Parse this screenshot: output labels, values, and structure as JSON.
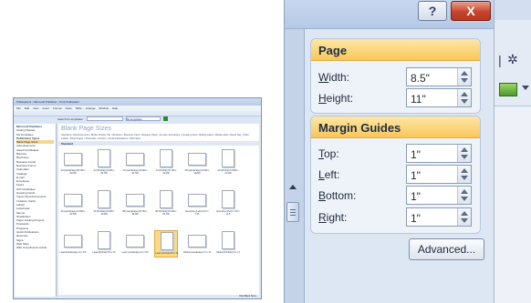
{
  "dialog": {
    "help_label": "?",
    "close_label": "X",
    "page_group": {
      "title": "Page",
      "width_label_u": "W",
      "width_label_rest": "idth:",
      "width_value": "8.5\"",
      "height_label_u": "H",
      "height_label_rest": "eight:",
      "height_value": "11\""
    },
    "margin_group": {
      "title": "Margin Guides",
      "top_label_u": "T",
      "top_label_rest": "op:",
      "top_value": "1\"",
      "left_label_u": "L",
      "left_label_rest": "eft:",
      "left_value": "1\"",
      "bottom_label_u": "B",
      "bottom_label_rest": "ottom:",
      "bottom_value": "1\"",
      "right_label_u": "R",
      "right_label_rest": "ight:",
      "right_value": "1\""
    },
    "advanced_label": "Advanced..."
  },
  "background_app": {
    "icons": [
      "|",
      "✲"
    ]
  },
  "thumbnail": {
    "title": "Publication1 - Microsoft Publisher - Print Publication",
    "menu": [
      "File",
      "Edit",
      "View",
      "Insert",
      "Format",
      "Tools",
      "Table",
      "Arrange",
      "Window",
      "Help"
    ],
    "search_label": "Search for templates:",
    "search_scope": "All templates",
    "sidebar_heading1": "Microsoft Publisher",
    "sidebar_top": [
      "Getting Started",
      "My Templates"
    ],
    "sidebar_heading2": "Publication Types",
    "sidebar_items": [
      "Blank Page Sizes",
      "Advertisements",
      "Award Certificates",
      "Banners",
      "Brochures",
      "Business Cards",
      "Business Forms",
      "Calendars",
      "Catalogs",
      "E-mail",
      "Envelopes",
      "Flyers",
      "Gift Certificates",
      "Greeting Cards",
      "Import Word Documents",
      "Invitation Cards",
      "Labels",
      "Letterhead",
      "Menus",
      "Newsletters",
      "Paper Folding Projects",
      "Postcards",
      "Programs",
      "Quick Publications",
      "Resumes",
      "Signs",
      "Web Sites",
      "With Compliments Cards"
    ],
    "heading": "Blank Page Sizes",
    "crumb": "Standard • Advertisements • Binder Divider Tab • Booklets • Business Card • Designer Paper • E-mail • Envelopes • Greeting Card • Mailing Label • Media Label • Name Tag • Other Labels • Photo Paper • Postcards • Posters • Small Publications • Web Sites",
    "band": "Standard",
    "cards": [
      "A4 (Landscape) 29.700 x 21.000",
      "A4 (Portrait) 21.000 x 29.700",
      "A3 (Landscape) 42.000 x 29.700",
      "A3 (Portrait) 29.700 x 42.000",
      "A5 (Landscape) 21.000 x 14.800",
      "A5 (Portrait) 14.800 x 21.000",
      "A6 (Landscape) 14.800 x 10.500",
      "A6 (Portrait) 10.500 x 14.800",
      "B5 (Landscape) 25.700 x 18.200",
      "B5 (Portrait) 18.200 x 25.700",
      "Executive (Land) 10.5 x 7.25",
      "Executive (Portr) 7.25 x 10.5",
      "Legal (Landscape) 14 x 8.5",
      "Legal (Portrait) 8.5 x 14",
      "Letter (Landscape) 11 x 8.5",
      "Letter (Portrait) 8.5 x 11",
      "Tabloid (Landscape) 17 x 11",
      "Tabloid (Portrait) 11 x 17"
    ],
    "selected_card": 15,
    "status": "Hide Blank Sizes"
  }
}
